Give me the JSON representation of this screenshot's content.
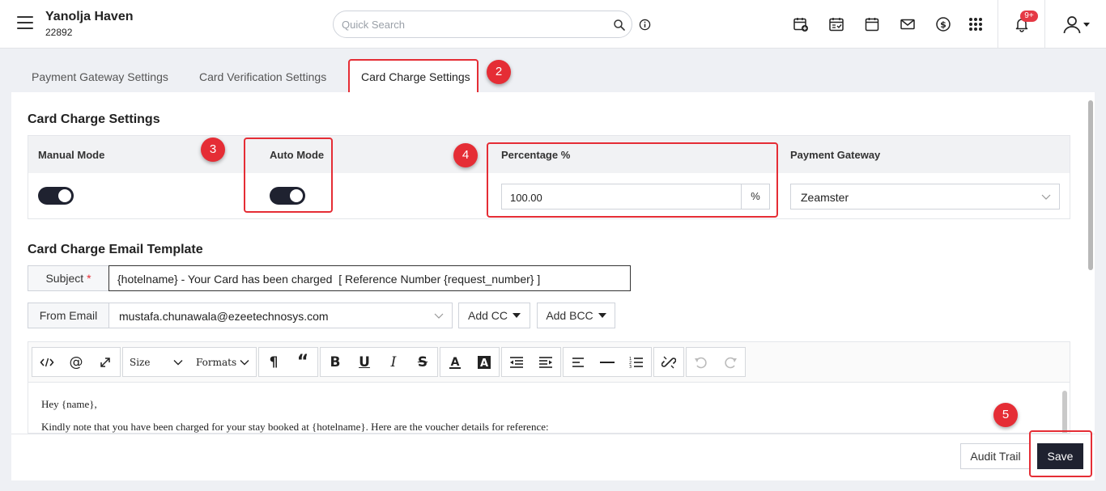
{
  "header": {
    "hotel_name": "Yanolja Haven",
    "hotel_id": "22892",
    "search_placeholder": "Quick Search",
    "notification_badge": "9+",
    "icons": [
      "calendar-add-icon",
      "calendar-check-icon",
      "calendar-icon",
      "mail-icon",
      "dollar-icon",
      "apps-grid-icon",
      "bell-icon",
      "user-icon"
    ]
  },
  "tabs": [
    {
      "label": "Payment Gateway Settings",
      "active": false
    },
    {
      "label": "Card Verification Settings",
      "active": false
    },
    {
      "label": "Card Charge Settings",
      "active": true
    }
  ],
  "steps": [
    "2",
    "3",
    "4",
    "5"
  ],
  "card_charge": {
    "title": "Card Charge Settings",
    "columns": {
      "manual_mode": "Manual Mode",
      "auto_mode": "Auto Mode",
      "percentage": "Percentage %",
      "payment_gateway": "Payment Gateway"
    },
    "manual_mode_on": true,
    "auto_mode_on": true,
    "percentage_value": "100.00",
    "percentage_suffix": "%",
    "payment_gateway_value": "Zeamster"
  },
  "email_template": {
    "title": "Card Charge Email Template",
    "subject_label": "Subject",
    "required_mark": "*",
    "subject_value": "{hotelname} - Your Card has been charged  [ Reference Number {request_number} ]",
    "from_label": "From Email",
    "from_value": "mustafa.chunawala@ezeetechnosys.com",
    "add_cc": "Add CC",
    "add_bcc": "Add BCC"
  },
  "editor": {
    "size_label": "Size",
    "formats_label": "Formats",
    "body_lines": [
      "Hey {name},",
      "Kindly note that you have been charged for your stay booked at {hotelname}. Here are the voucher details for reference:"
    ]
  },
  "footer": {
    "audit_trail": "Audit Trail",
    "save": "Save"
  },
  "colors": {
    "accent_red": "#e52d35",
    "dark": "#1f2230"
  }
}
